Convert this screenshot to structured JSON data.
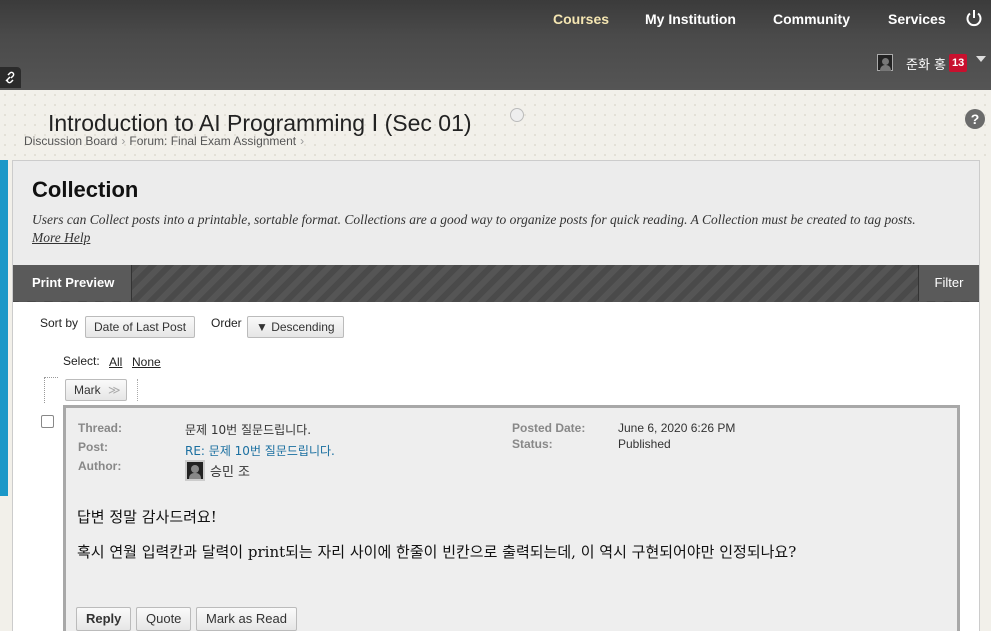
{
  "nav": {
    "items": [
      "Courses",
      "My Institution",
      "Community",
      "Services"
    ],
    "active": "Courses"
  },
  "user": {
    "name": "준화 홍",
    "notifications": "13"
  },
  "course": {
    "title": "Introduction to AI Programming Ⅰ (Sec 01)",
    "breadcrumb": [
      "Discussion Board",
      "Forum: Final Exam Assignment"
    ]
  },
  "collection": {
    "title": "Collection",
    "description": "Users can Collect posts into a printable, sortable format. Collections are a good way to organize posts for quick reading. A Collection must be created to tag posts.",
    "more_help": "More Help"
  },
  "actionbar": {
    "print_preview": "Print Preview",
    "filter": "Filter"
  },
  "sort": {
    "sort_by_label": "Sort by",
    "sort_by_value": "Date of Last Post",
    "order_label": "Order",
    "order_value": "▼ Descending"
  },
  "select": {
    "label": "Select:",
    "all": "All",
    "none": "None",
    "mark": "Mark"
  },
  "post": {
    "thread_label": "Thread:",
    "thread": "문제 10번 질문드립니다.",
    "post_label": "Post:",
    "post": "RE: 문제 10번 질문드립니다.",
    "author_label": "Author:",
    "author": "승민 조",
    "posted_date_label": "Posted Date:",
    "posted_date": "June 6, 2020 6:26 PM",
    "status_label": "Status:",
    "status": "Published",
    "body_line1": "답변 정말 감사드려요!",
    "body_line2": "혹시 연월 입력칸과 달력이 print되는 자리 사이에 한줄이 빈칸으로 출력되는데, 이 역시 구현되어야만 인정되나요?",
    "reply": "Reply",
    "quote": "Quote",
    "mark_as_read": "Mark as Read"
  }
}
